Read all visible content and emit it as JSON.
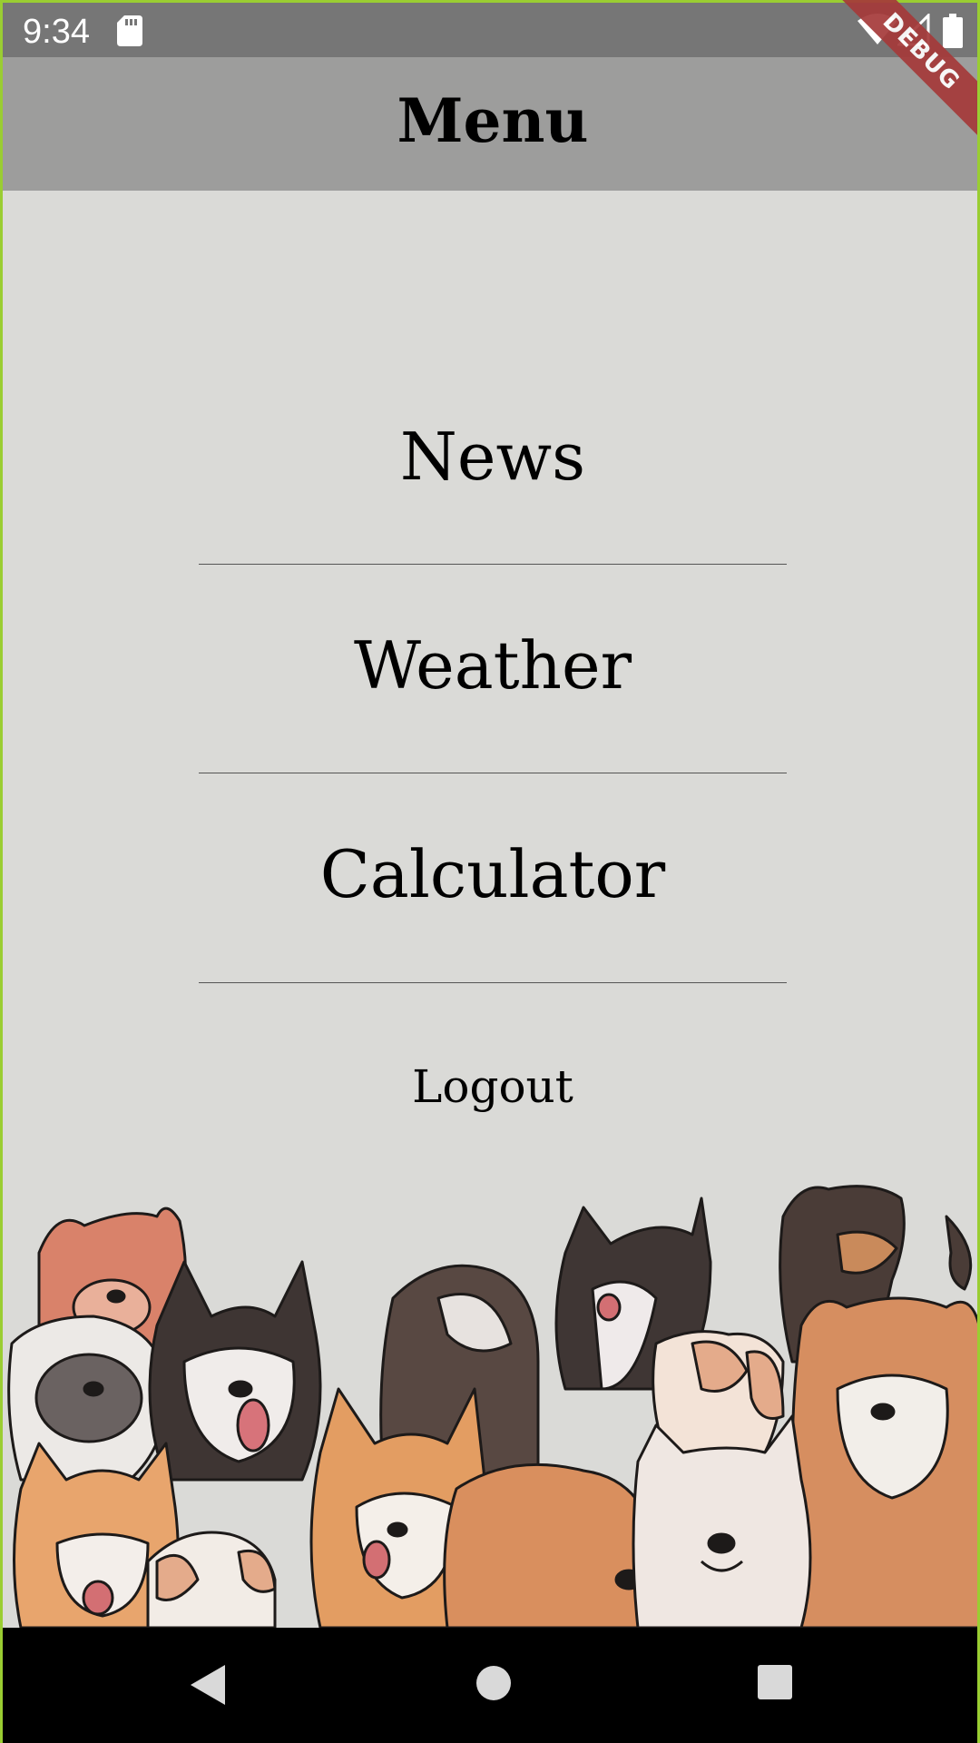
{
  "status_bar": {
    "time": "9:34",
    "icons": [
      "sd-card-icon",
      "wifi-icon",
      "cell-signal-icon",
      "battery-icon"
    ]
  },
  "app_bar": {
    "title": "Menu"
  },
  "debug_banner": "DEBUG",
  "menu": {
    "items": [
      {
        "label": "News"
      },
      {
        "label": "Weather"
      },
      {
        "label": "Calculator"
      }
    ],
    "logout_label": "Logout"
  },
  "illustration": {
    "name": "dogs-illustration"
  },
  "nav_bar": {
    "icons": [
      "back-icon",
      "home-icon",
      "recents-icon"
    ]
  },
  "colors": {
    "background": "#dadad7",
    "app_bar": "#9d9d9c",
    "status_bar": "#767676",
    "debug_ribbon": "#a53a3a"
  }
}
